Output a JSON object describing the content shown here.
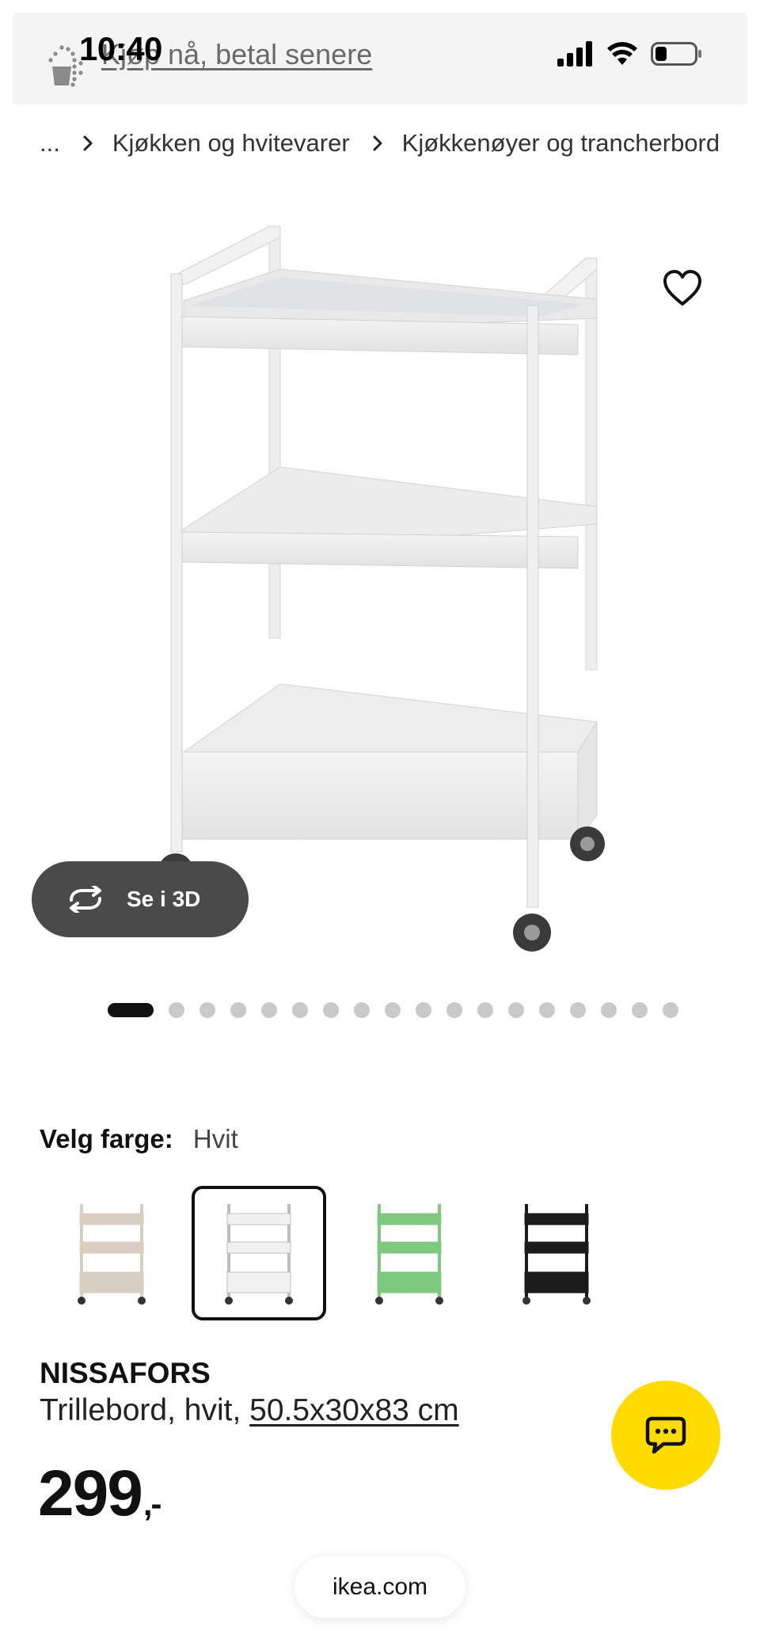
{
  "status_bar": {
    "time": "10:40",
    "promo_link": "Kjøp nå, betal senere",
    "icons": [
      "signal-icon",
      "wifi-icon",
      "battery-icon"
    ]
  },
  "breadcrumb": {
    "items": [
      "...",
      "Kjøkken og hvitevarer",
      "Kjøkkenøyer og trancherbord"
    ]
  },
  "gallery": {
    "view_3d_label": "Se i 3D",
    "image_count": 18,
    "active_index": 0
  },
  "color_picker": {
    "label": "Velg farge:",
    "selected": "Hvit",
    "swatches": [
      {
        "color": "#d8cfc2"
      },
      {
        "color": "#f1f1f1"
      },
      {
        "color": "#7fc97f"
      },
      {
        "color": "#1b1b1b"
      }
    ],
    "selected_index": 1
  },
  "product": {
    "name": "NISSAFORS",
    "description": "Trillebord, hvit,",
    "size": "50.5x30x83 cm",
    "price": "299",
    "price_suffix": ",-"
  },
  "browser": {
    "url": "ikea.com"
  },
  "colors": {
    "chat_button": "#ffdb00",
    "view3d_button": "#4a4a4a",
    "dot_active": "#111111",
    "dot_inactive": "#c9c9c9"
  }
}
